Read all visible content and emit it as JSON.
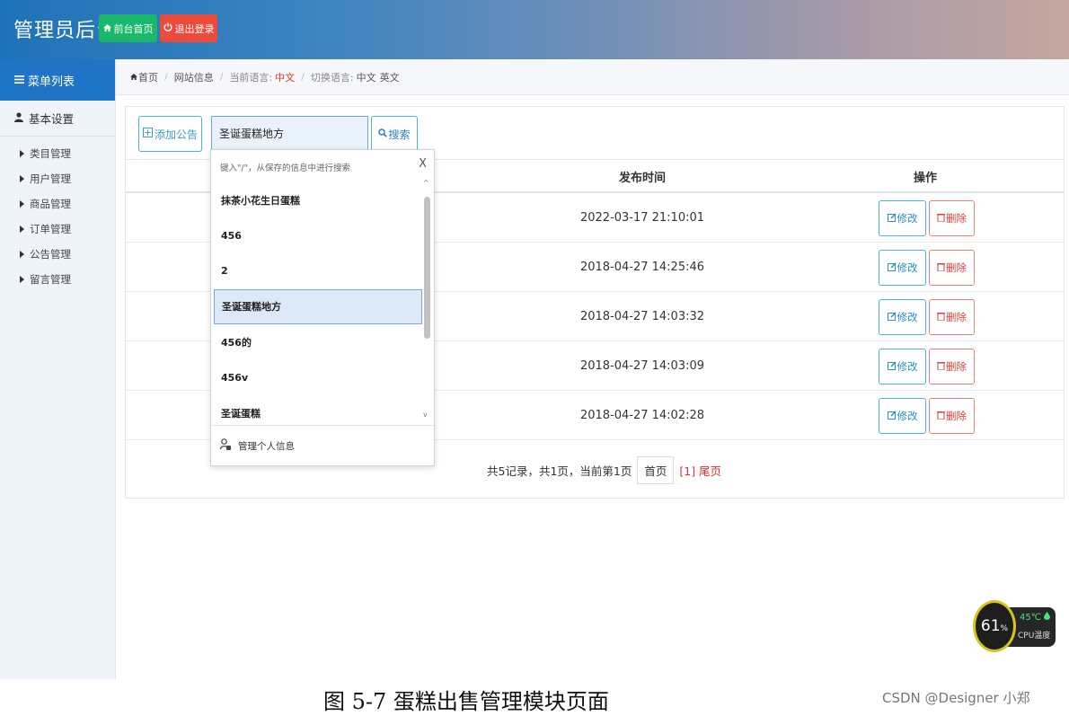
{
  "header": {
    "title": "管理员后台",
    "home_button": "前台首页",
    "logout_button": "退出登录"
  },
  "sidebar": {
    "menu_title": "菜单列表",
    "group_title": "基本设置",
    "items": [
      {
        "label": "类目管理"
      },
      {
        "label": "用户管理"
      },
      {
        "label": "商品管理"
      },
      {
        "label": "订单管理"
      },
      {
        "label": "公告管理"
      },
      {
        "label": "留言管理"
      }
    ]
  },
  "breadcrumb": {
    "home": "首页",
    "section": "网站信息",
    "current_lang_label": "当前语言:",
    "current_lang": "中文",
    "switch_lang_label": "切换语言:",
    "lang_zh": "中文",
    "lang_en": "英文"
  },
  "toolbar": {
    "add_button": "添加公告",
    "search_value": "圣诞蛋糕地方",
    "search_button": "搜索"
  },
  "table": {
    "columns": {
      "time": "发布时间",
      "ops": "操作"
    },
    "rows": [
      {
        "time": "2022-03-17 21:10:01"
      },
      {
        "time": "2018-04-27 14:25:46"
      },
      {
        "time": "2018-04-27 14:03:32"
      },
      {
        "time": "2018-04-27 14:03:09"
      },
      {
        "time": "2018-04-27 14:02:28"
      }
    ],
    "edit_label": "修改",
    "delete_label": "删除"
  },
  "pagination": {
    "summary": "共5记录，共1页，当前第1页",
    "first": "首页",
    "last": "[1] 尾页"
  },
  "autocomplete": {
    "hint": "键入\"/\"，从保存的信息中进行搜索",
    "close": "X",
    "items": [
      "抹茶小花生日蛋糕",
      "456",
      "2",
      "圣诞蛋糕地方",
      "456的",
      "456v",
      "圣诞蛋糕"
    ],
    "selected_index": 3,
    "footer": "管理个人信息"
  },
  "caption": "图 5-7  蛋糕出售管理模块页面",
  "watermark": "CSDN @Designer 小郑",
  "cpu_widget": {
    "usage": "61",
    "usage_unit": "%",
    "temp": "45℃",
    "label": "CPU温度"
  },
  "colors": {
    "primary": "#1f74c6",
    "success": "#1ab86b",
    "danger": "#ec4a3b",
    "info_border": "#4ab1cf"
  }
}
